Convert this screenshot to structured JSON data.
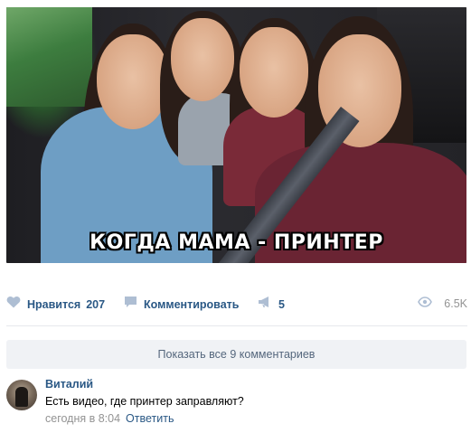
{
  "post": {
    "image_caption": "КОГДА МАМА - ПРИНТЕР"
  },
  "actions": {
    "like_label": "Нравится",
    "like_count": "207",
    "comment_label": "Комментировать",
    "share_count": "5",
    "views_count": "6.5K"
  },
  "comments": {
    "show_all_label": "Показать все 9 комментариев",
    "items": [
      {
        "author": "Виталий",
        "text": "Есть видео, где принтер заправляют?",
        "time": "сегодня в 8:04",
        "reply_label": "Ответить"
      }
    ]
  },
  "colors": {
    "link": "#2a5885",
    "muted": "#939393",
    "icon": "#aebed3",
    "bar_bg": "#f0f2f5"
  },
  "icons": {
    "like": "heart-icon",
    "comment": "speech-bubble-icon",
    "share": "megaphone-icon",
    "views": "eye-icon"
  }
}
